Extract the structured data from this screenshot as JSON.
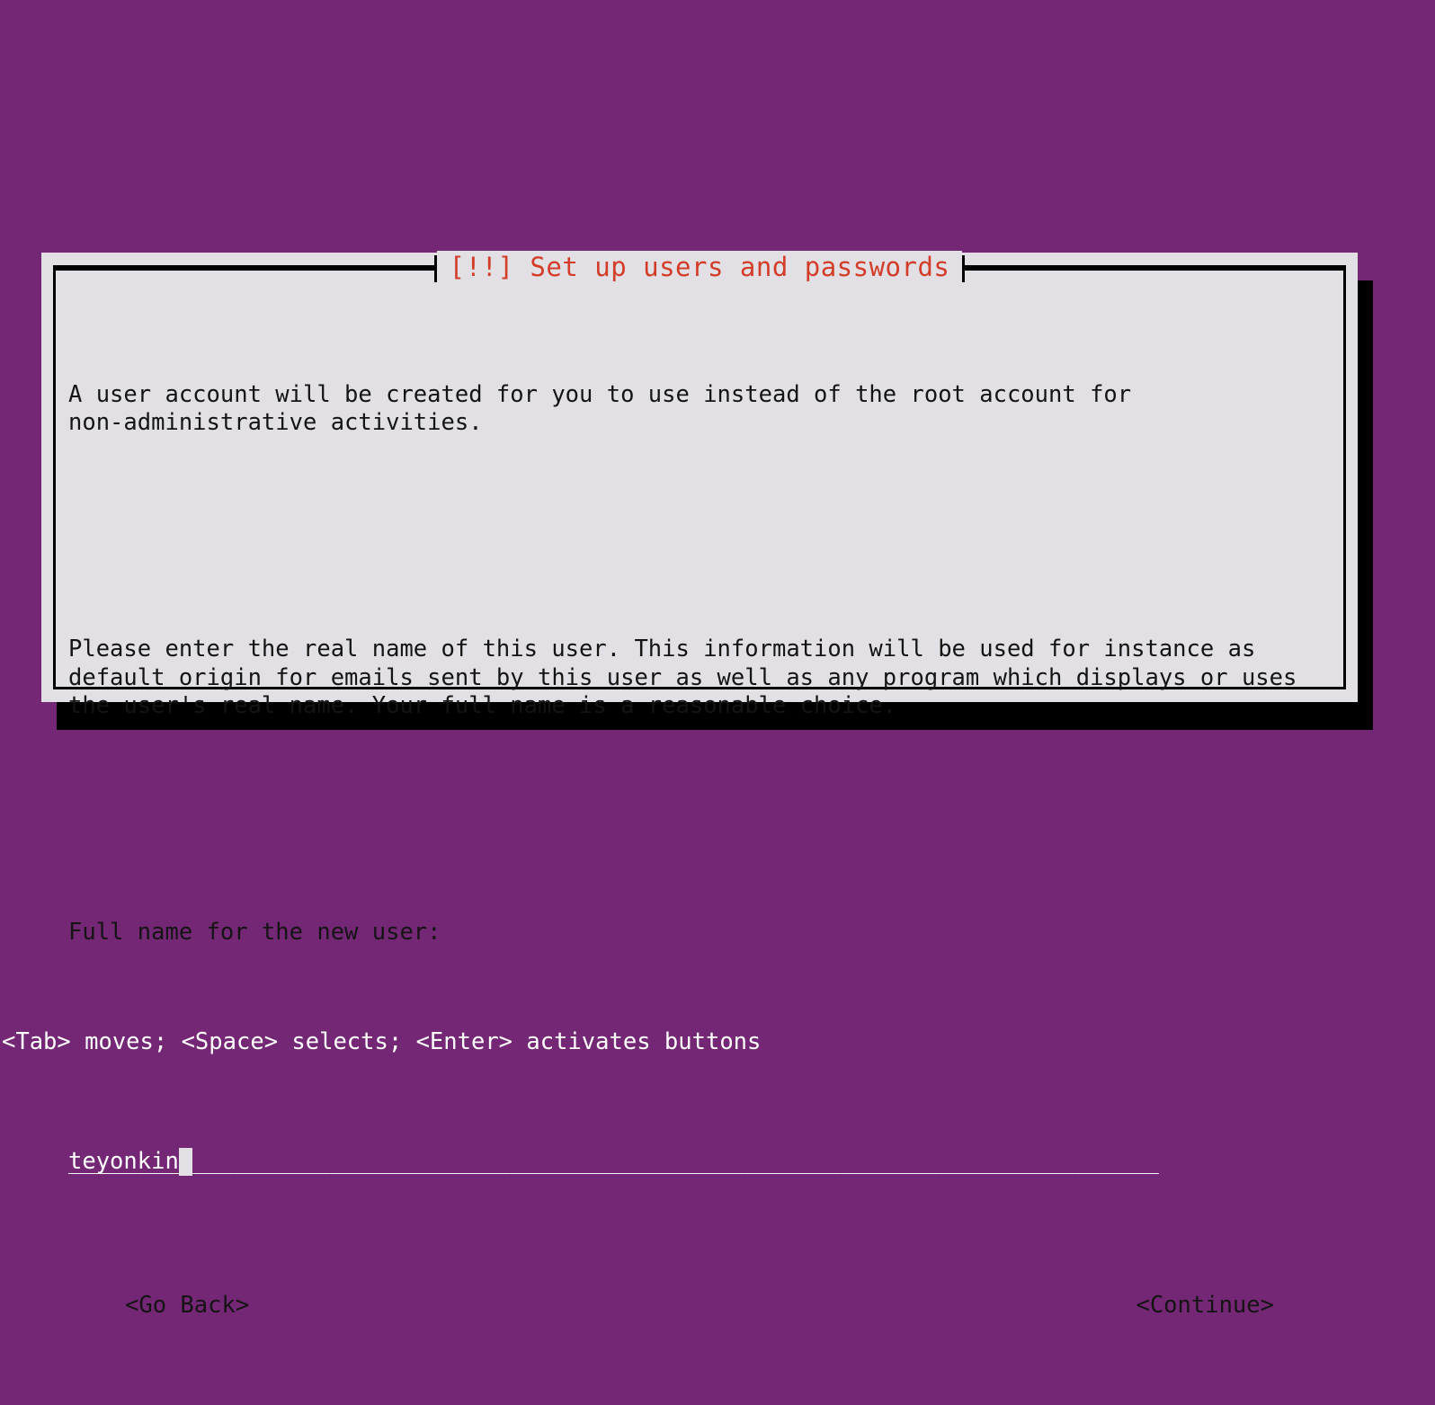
{
  "screen": {
    "background_color": "#742775",
    "foreground_color": "#e2e0e4"
  },
  "dialog": {
    "title": "[!!] Set up users and passwords",
    "title_color": "#d33c28",
    "background_color": "#e2e0e4",
    "border_color": "#000000",
    "paragraphs": [
      "A user account will be created for you to use instead of the root account for\nnon-administrative activities.",
      "Please enter the real name of this user. This information will be used for instance as\ndefault origin for emails sent by this user as well as any program which displays or uses\nthe user's real name. Your full name is a reasonable choice."
    ],
    "field_label": "Full name for the new user:",
    "input": {
      "value": "teyonkin",
      "fill_char": "_",
      "fill": "_______________________________________________________________________________",
      "field_color": "#742775",
      "text_color": "#ffffff",
      "cursor_color": "#e2e0e4"
    },
    "buttons": {
      "go_back": "<Go Back>",
      "continue": "<Continue>"
    }
  },
  "status_bar": {
    "text": "<Tab> moves; <Space> selects; <Enter> activates buttons",
    "text_color": "#ffffff"
  }
}
